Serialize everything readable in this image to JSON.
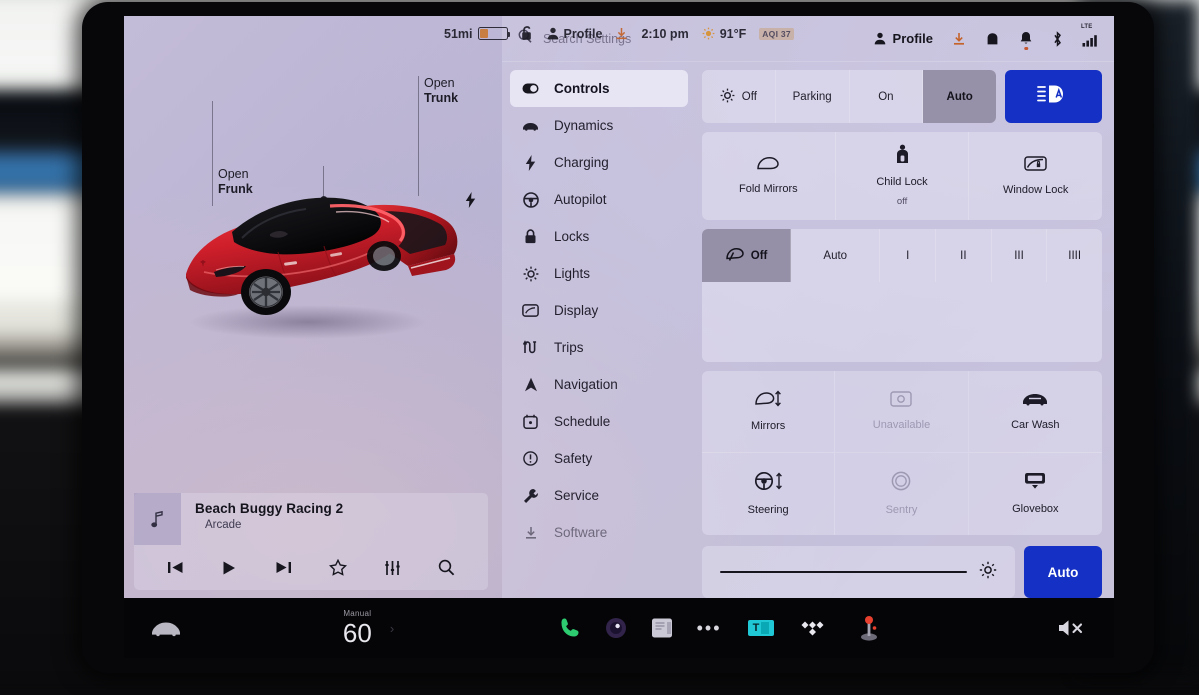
{
  "statusbar": {
    "range": "51mi",
    "lock_icon": "unlock-icon",
    "profile": "Profile",
    "time": "2:10 pm",
    "temperature": "91°F",
    "aqi": "AQI 37"
  },
  "left_pane": {
    "labels": [
      {
        "line1": "Open",
        "line2": "Frunk"
      },
      {
        "line1": "Open",
        "line2": "Trunk"
      }
    ],
    "media": {
      "title": "Beach Buggy Racing 2",
      "subtitle": "Arcade",
      "art_icon": "music-note-icon",
      "controls": [
        {
          "name": "previous-track-button",
          "glyph": "⏮"
        },
        {
          "name": "play-button",
          "glyph": "▶"
        },
        {
          "name": "next-track-button",
          "glyph": "⏭"
        },
        {
          "name": "favorite-button",
          "glyph": "☆"
        },
        {
          "name": "equalizer-button",
          "glyph": "|||"
        },
        {
          "name": "search-media-button",
          "glyph": "search"
        }
      ]
    }
  },
  "settings": {
    "search": {
      "placeholder": "Search Settings",
      "value": ""
    },
    "profile_label": "Profile",
    "top_icons": [
      "download-icon",
      "car-top-icon",
      "bell-icon",
      "bluetooth-icon",
      "lte-signal-icon"
    ],
    "lte_label": "LTE",
    "sidebar": [
      {
        "label": "Controls",
        "icon": "toggle-icon",
        "active": true
      },
      {
        "label": "Dynamics",
        "icon": "car-icon",
        "active": false
      },
      {
        "label": "Charging",
        "icon": "bolt-icon",
        "active": false
      },
      {
        "label": "Autopilot",
        "icon": "steering-icon",
        "active": false
      },
      {
        "label": "Locks",
        "icon": "lock-icon",
        "active": false
      },
      {
        "label": "Lights",
        "icon": "light-icon",
        "active": false
      },
      {
        "label": "Display",
        "icon": "display-icon",
        "active": false
      },
      {
        "label": "Trips",
        "icon": "trips-icon",
        "active": false
      },
      {
        "label": "Navigation",
        "icon": "navigation-icon",
        "active": false
      },
      {
        "label": "Schedule",
        "icon": "clock-icon",
        "active": false
      },
      {
        "label": "Safety",
        "icon": "info-icon",
        "active": false
      },
      {
        "label": "Service",
        "icon": "wrench-icon",
        "active": false
      },
      {
        "label": "Software",
        "icon": "download-icon",
        "active": false
      }
    ],
    "headlights": {
      "options": [
        {
          "label": "Off",
          "icon": "headlight-icon",
          "selected": false
        },
        {
          "label": "Parking",
          "icon": "",
          "selected": false
        },
        {
          "label": "On",
          "icon": "",
          "selected": false
        },
        {
          "label": "Auto",
          "icon": "",
          "selected": true
        }
      ],
      "high_beam_button": "auto-high-beam-icon"
    },
    "mirror_row": [
      {
        "label": "Fold Mirrors",
        "sub": "",
        "icon": "mirror-icon",
        "dim": false
      },
      {
        "label": "Child Lock",
        "sub": "off",
        "icon": "child-lock-icon",
        "dim": false
      },
      {
        "label": "Window Lock",
        "sub": "",
        "icon": "window-lock-icon",
        "dim": false
      }
    ],
    "wipers": [
      {
        "label": "Off",
        "icon": "wiper-icon",
        "selected": true
      },
      {
        "label": "Auto",
        "icon": "",
        "selected": false
      },
      {
        "label": "I",
        "icon": "",
        "selected": false
      },
      {
        "label": "II",
        "icon": "",
        "selected": false
      },
      {
        "label": "III",
        "icon": "",
        "selected": false
      },
      {
        "label": "IIII",
        "icon": "",
        "selected": false
      }
    ],
    "grid": [
      {
        "label": "Mirrors",
        "icon": "mirror-adjust-icon",
        "dim": false
      },
      {
        "label": "Unavailable",
        "icon": "unavailable-icon",
        "dim": true
      },
      {
        "label": "Car Wash",
        "icon": "car-wash-icon",
        "dim": false
      },
      {
        "label": "Steering",
        "icon": "steering-adjust-icon",
        "dim": false
      },
      {
        "label": "Sentry",
        "icon": "sentry-icon",
        "dim": true
      },
      {
        "label": "Glovebox",
        "icon": "glovebox-icon",
        "dim": false
      }
    ],
    "brightness": {
      "value": 96,
      "icon": "brightness-icon",
      "auto_label": "Auto"
    }
  },
  "taskbar": {
    "car_icon": "car-icon",
    "climate": {
      "mode": "Manual",
      "value": "60"
    },
    "items": [
      {
        "name": "phone-icon",
        "label": ""
      },
      {
        "name": "camera-icon",
        "label": ""
      },
      {
        "name": "card-icon",
        "label": ""
      },
      {
        "name": "more-icon",
        "label": "•••"
      },
      {
        "name": "tunein-icon",
        "label": "T"
      },
      {
        "name": "tidal-icon",
        "label": ""
      },
      {
        "name": "arcade-icon",
        "label": ""
      },
      {
        "name": "mute-icon",
        "label": ""
      }
    ]
  },
  "colors": {
    "accent_blue": "#1530c4",
    "screen_tint": "#b8b2d2",
    "tunein_teal": "#1fc8d4",
    "battery_orange": "#c97a34"
  }
}
